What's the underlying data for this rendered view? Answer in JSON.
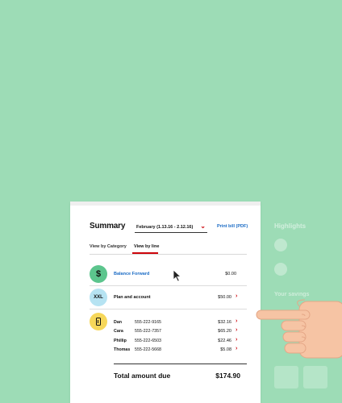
{
  "summary": {
    "title": "Summary",
    "period": "February (1.13.16 - 2.12.16)",
    "print_link": "Print bill (PDF)"
  },
  "tabs": [
    {
      "label": "View by Category",
      "active": false
    },
    {
      "label": "View by line",
      "active": true
    }
  ],
  "balance": {
    "label": "Balance Forward",
    "amount": "$0.00",
    "icon": "dollar-sign",
    "icon_text": "$"
  },
  "plan": {
    "label": "Plan and account",
    "amount": "$50.00",
    "icon": "xxl-badge",
    "icon_text": "XXL"
  },
  "lines": [
    {
      "name": "Dan",
      "number": "555-222-9165",
      "amount": "$32.16"
    },
    {
      "name": "Cara",
      "number": "555-222-7357",
      "amount": "$65.20"
    },
    {
      "name": "Phillip",
      "number": "555-222-6503",
      "amount": "$22.46"
    },
    {
      "name": "Thomas",
      "number": "555-222-5668",
      "amount": "$5.08"
    }
  ],
  "total": {
    "label": "Total amount due",
    "amount": "$174.90"
  },
  "colors": {
    "background": "#9ddcb6",
    "accent_red": "#cd040b",
    "link_blue": "#1a6bc5",
    "balance_icon": "#5cc58d",
    "plan_icon": "#b6e3f2",
    "lines_icon": "#f6d75a",
    "hand": "#f6c4a4"
  },
  "ghost_panel": {
    "title": "Highlights",
    "subtitle": "Your savings"
  }
}
